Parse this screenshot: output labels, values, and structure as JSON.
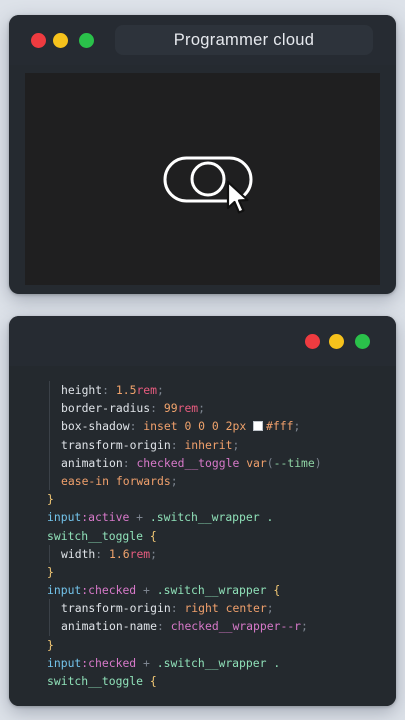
{
  "colors": {
    "page_bg": "#dde2e9",
    "window_bg": "#252a30",
    "close": "#ee3b40",
    "minimize": "#f6c21c",
    "maximize": "#2ac14a"
  },
  "preview_window": {
    "title": "Programmer cloud",
    "traffic_lights": [
      "close",
      "minimize",
      "maximize"
    ],
    "canvas": {
      "toggle": {
        "state": "off",
        "icon": "toggle-switch-icon"
      },
      "cursor": {
        "icon": "mouse-pointer-icon"
      }
    }
  },
  "code_window": {
    "traffic_lights": [
      "close",
      "minimize",
      "maximize"
    ],
    "lines": [
      {
        "indent": 1,
        "tokens": [
          {
            "t": "height",
            "c": "prop"
          },
          {
            "t": ": ",
            "c": "punc"
          },
          {
            "t": "1.5",
            "c": "num"
          },
          {
            "t": "rem",
            "c": "unit"
          },
          {
            "t": ";",
            "c": "punc"
          }
        ]
      },
      {
        "indent": 1,
        "tokens": [
          {
            "t": "border-radius",
            "c": "prop"
          },
          {
            "t": ": ",
            "c": "punc"
          },
          {
            "t": "99",
            "c": "num"
          },
          {
            "t": "rem",
            "c": "unit"
          },
          {
            "t": ";",
            "c": "punc"
          }
        ]
      },
      {
        "indent": 1,
        "tokens": [
          {
            "t": "box-shadow",
            "c": "prop"
          },
          {
            "t": ": ",
            "c": "punc"
          },
          {
            "t": "inset",
            "c": "kw"
          },
          {
            "t": " ",
            "c": "punc"
          },
          {
            "t": "0",
            "c": "num"
          },
          {
            "t": " ",
            "c": "punc"
          },
          {
            "t": "0",
            "c": "num"
          },
          {
            "t": " ",
            "c": "punc"
          },
          {
            "t": "0",
            "c": "num"
          },
          {
            "t": " ",
            "c": "punc"
          },
          {
            "t": "2px",
            "c": "num"
          },
          {
            "t": " ",
            "c": "punc"
          },
          {
            "t": "",
            "c": "swatch"
          },
          {
            "t": "#fff",
            "c": "hex"
          },
          {
            "t": ";",
            "c": "punc"
          }
        ]
      },
      {
        "indent": 1,
        "tokens": [
          {
            "t": "transform-origin",
            "c": "prop"
          },
          {
            "t": ": ",
            "c": "punc"
          },
          {
            "t": "inherit",
            "c": "kw"
          },
          {
            "t": ";",
            "c": "punc"
          }
        ]
      },
      {
        "indent": 1,
        "tokens": [
          {
            "t": "animation",
            "c": "prop"
          },
          {
            "t": ": ",
            "c": "punc"
          },
          {
            "t": "checked__toggle",
            "c": "fn"
          },
          {
            "t": " ",
            "c": "punc"
          },
          {
            "t": "var",
            "c": "kw"
          },
          {
            "t": "(",
            "c": "punc"
          },
          {
            "t": "--time",
            "c": "var"
          },
          {
            "t": ")",
            "c": "punc"
          }
        ]
      },
      {
        "indent": 1,
        "tokens": [
          {
            "t": "ease-in forwards",
            "c": "kw"
          },
          {
            "t": ";",
            "c": "punc"
          }
        ]
      },
      {
        "indent": 0,
        "tokens": [
          {
            "t": "}",
            "c": "brace"
          }
        ]
      },
      {
        "indent": 0,
        "tokens": [
          {
            "t": "input",
            "c": "sel"
          },
          {
            "t": ":active",
            "c": "pseudo"
          },
          {
            "t": " + ",
            "c": "punc"
          },
          {
            "t": ".switch__wrapper",
            "c": "cls"
          },
          {
            "t": " .",
            "c": "cls"
          }
        ]
      },
      {
        "indent": 0,
        "tokens": [
          {
            "t": "switch__toggle",
            "c": "cls"
          },
          {
            "t": " {",
            "c": "brace"
          }
        ]
      },
      {
        "indent": 1,
        "tokens": [
          {
            "t": "width",
            "c": "prop"
          },
          {
            "t": ": ",
            "c": "punc"
          },
          {
            "t": "1.6",
            "c": "num"
          },
          {
            "t": "rem",
            "c": "unit"
          },
          {
            "t": ";",
            "c": "punc"
          }
        ]
      },
      {
        "indent": 0,
        "tokens": [
          {
            "t": "}",
            "c": "brace"
          }
        ]
      },
      {
        "indent": 0,
        "tokens": [
          {
            "t": "input",
            "c": "sel"
          },
          {
            "t": ":checked",
            "c": "pseudo"
          },
          {
            "t": " + ",
            "c": "punc"
          },
          {
            "t": ".switch__wrapper",
            "c": "cls"
          },
          {
            "t": " {",
            "c": "brace"
          }
        ]
      },
      {
        "indent": 1,
        "tokens": [
          {
            "t": "transform-origin",
            "c": "prop"
          },
          {
            "t": ": ",
            "c": "punc"
          },
          {
            "t": "right center",
            "c": "kw"
          },
          {
            "t": ";",
            "c": "punc"
          }
        ]
      },
      {
        "indent": 1,
        "tokens": [
          {
            "t": "animation-name",
            "c": "prop"
          },
          {
            "t": ": ",
            "c": "punc"
          },
          {
            "t": "checked__wrapper--r",
            "c": "fn"
          },
          {
            "t": ";",
            "c": "punc"
          }
        ]
      },
      {
        "indent": 0,
        "tokens": [
          {
            "t": "}",
            "c": "brace"
          }
        ]
      },
      {
        "indent": 0,
        "tokens": [
          {
            "t": "input",
            "c": "sel"
          },
          {
            "t": ":checked",
            "c": "pseudo"
          },
          {
            "t": " + ",
            "c": "punc"
          },
          {
            "t": ".switch__wrapper",
            "c": "cls"
          },
          {
            "t": " .",
            "c": "cls"
          }
        ]
      },
      {
        "indent": 0,
        "tokens": [
          {
            "t": "switch__toggle",
            "c": "cls"
          },
          {
            "t": " {",
            "c": "brace"
          }
        ]
      }
    ]
  }
}
